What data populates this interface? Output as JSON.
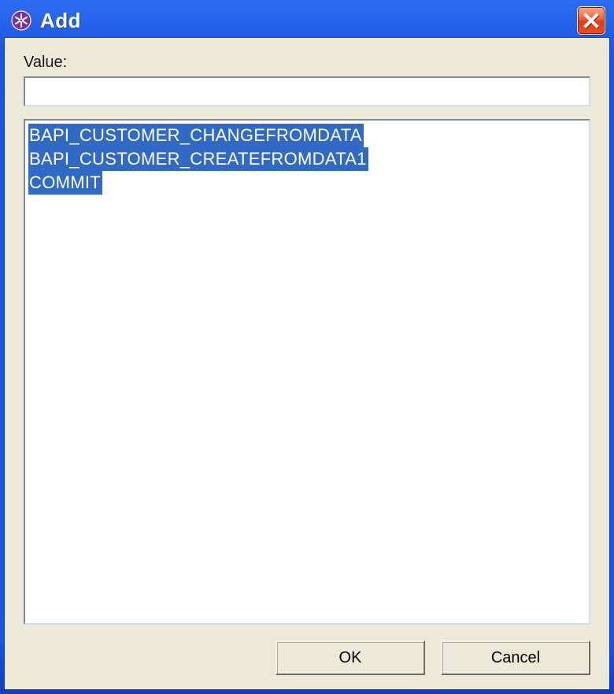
{
  "window": {
    "title": "Add"
  },
  "form": {
    "value_label": "Value:",
    "value_text": ""
  },
  "listbox": {
    "items": [
      "BAPI_CUSTOMER_CHANGEFROMDATA",
      "BAPI_CUSTOMER_CREATEFROMDATA1",
      "COMMIT"
    ],
    "selected": [
      0,
      1,
      2
    ]
  },
  "buttons": {
    "ok": "OK",
    "cancel": "Cancel"
  }
}
